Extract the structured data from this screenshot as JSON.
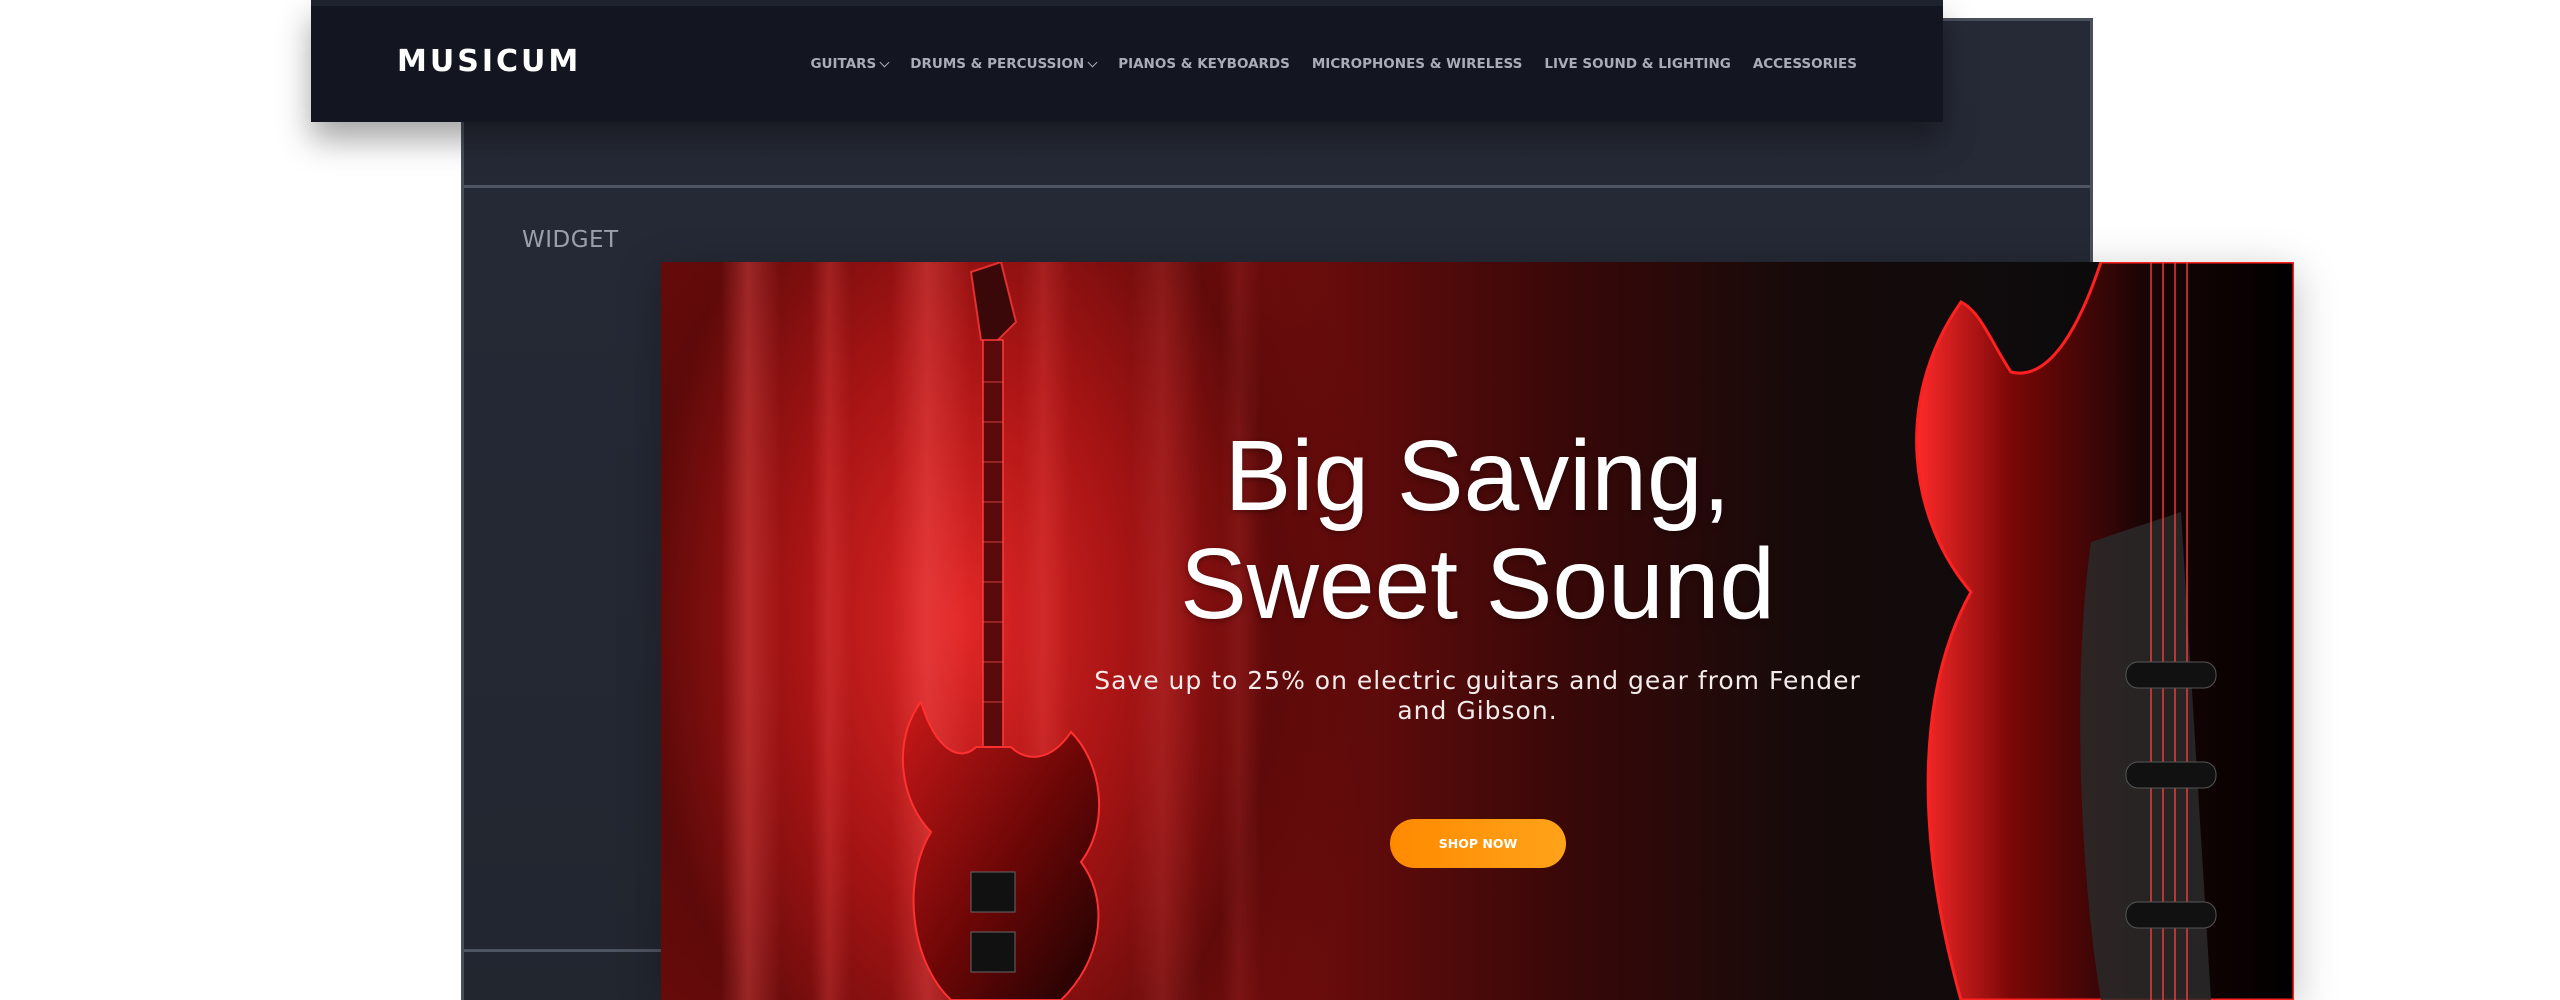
{
  "header": {
    "logo": "MUSICUM",
    "nav": [
      {
        "label": "GUITARS",
        "has_dropdown": true
      },
      {
        "label": "DRUMS & PERCUSSION",
        "has_dropdown": true
      },
      {
        "label": "PIANOS & KEYBOARDS",
        "has_dropdown": false
      },
      {
        "label": "MICROPHONES & WIRELESS",
        "has_dropdown": false
      },
      {
        "label": "LIVE SOUND & LIGHTING",
        "has_dropdown": false
      },
      {
        "label": "ACCESSORIES",
        "has_dropdown": false
      }
    ]
  },
  "panel": {
    "widget_label": "WIDGET"
  },
  "hero": {
    "title_line1": "Big Saving,",
    "title_line2": "Sweet Sound",
    "subtitle": "Save up to 25% on electric guitars and gear from Fender and Gibson.",
    "cta_label": "SHOP NOW"
  },
  "colors": {
    "header_bg": "#131621",
    "panel_bg": "#262a37",
    "accent_orange": "#ff8a00",
    "hero_red": "#9c1414"
  }
}
